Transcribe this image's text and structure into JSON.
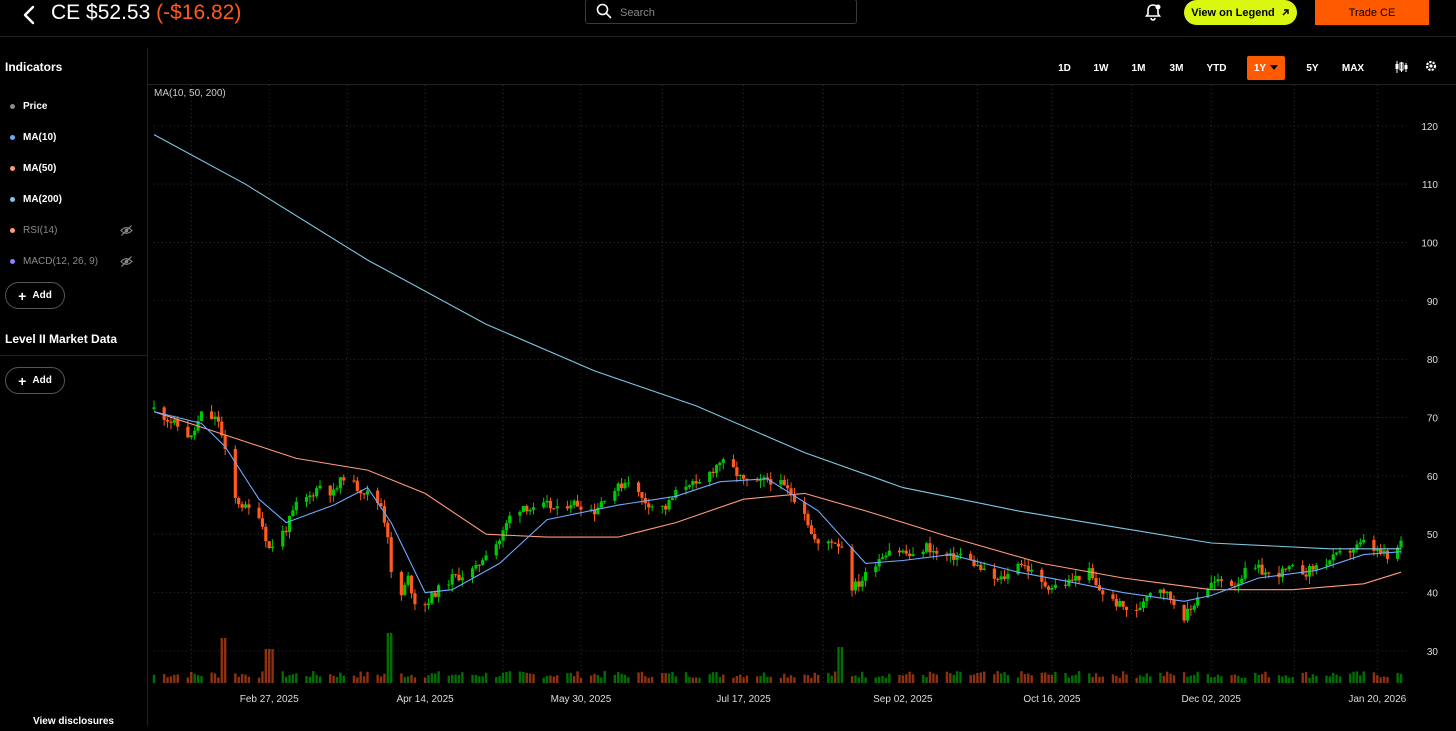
{
  "header": {
    "ticker": "CE",
    "price": "$52.53",
    "change": "(-$16.82)",
    "search_placeholder": "Search",
    "legend_button": "View on Legend",
    "trade_button": "Trade CE"
  },
  "sidebar": {
    "indicators_title": "Indicators",
    "indicators": [
      {
        "label": "Price",
        "color": "#8a8a8a",
        "hidden": false
      },
      {
        "label": "MA(10)",
        "color": "#6ea8ff",
        "hidden": false
      },
      {
        "label": "MA(50)",
        "color": "#ff9a7a",
        "hidden": false
      },
      {
        "label": "MA(200)",
        "color": "#7ec8e3",
        "hidden": false
      },
      {
        "label": "RSI(14)",
        "color": "#ff9a7a",
        "hidden": true
      },
      {
        "label": "MACD(12, 26, 9)",
        "color": "#9a7aff",
        "hidden": true
      }
    ],
    "add_label": "Add",
    "level2_title": "Level II Market Data",
    "add_label_2": "Add",
    "disclosures": "View disclosures"
  },
  "ranges": [
    "1D",
    "1W",
    "1M",
    "3M",
    "YTD",
    "1Y",
    "5Y",
    "MAX"
  ],
  "active_range": "1Y",
  "chart_data": {
    "type": "candlestick",
    "overlay_label": "MA(10, 50, 200)",
    "up_color": "#00c805",
    "down_color": "#ff5a1f",
    "ma10_color": "#6ea8ff",
    "ma50_color": "#ff9a7a",
    "ma200_color": "#7ec8e3",
    "y_ticks": [
      120,
      110,
      100,
      90,
      80,
      70,
      60,
      50,
      40,
      30
    ],
    "ylim": [
      24.5,
      127
    ],
    "x_range": [
      "2025-01-24",
      "2026-01-27"
    ],
    "x_ticks": [
      {
        "date": "2025-02-27",
        "label": "Feb 27, 2025"
      },
      {
        "date": "2025-04-14",
        "label": "Apr 14, 2025"
      },
      {
        "date": "2025-05-30",
        "label": "May 30, 2025"
      },
      {
        "date": "2025-07-17",
        "label": "Jul 17, 2025"
      },
      {
        "date": "2025-09-02",
        "label": "Sep 02, 2025"
      },
      {
        "date": "2025-10-16",
        "label": "Oct 16, 2025"
      },
      {
        "date": "2025-12-02",
        "label": "Dec 02, 2025"
      },
      {
        "date": "2026-01-20",
        "label": "Jan 20, 2026"
      }
    ],
    "price_path": [
      [
        "2025-01-24",
        71.5
      ],
      [
        "2025-01-31",
        68.5
      ],
      [
        "2025-02-04",
        66.5
      ],
      [
        "2025-02-07",
        70.5
      ],
      [
        "2025-02-12",
        69.5
      ],
      [
        "2025-02-14",
        64.0
      ],
      [
        "2025-02-17",
        56.0
      ],
      [
        "2025-02-20",
        54.5
      ],
      [
        "2025-02-24",
        53.5
      ],
      [
        "2025-02-27",
        47.5
      ],
      [
        "2025-03-04",
        51.0
      ],
      [
        "2025-03-07",
        55.0
      ],
      [
        "2025-03-11",
        56.5
      ],
      [
        "2025-03-14",
        58.5
      ],
      [
        "2025-03-18",
        57.0
      ],
      [
        "2025-03-21",
        60.0
      ],
      [
        "2025-03-25",
        58.0
      ],
      [
        "2025-03-28",
        57.0
      ],
      [
        "2025-04-01",
        55.0
      ],
      [
        "2025-04-03",
        50.0
      ],
      [
        "2025-04-04",
        43.0
      ],
      [
        "2025-04-07",
        39.5
      ],
      [
        "2025-04-09",
        42.5
      ],
      [
        "2025-04-11",
        38.5
      ],
      [
        "2025-04-14",
        38.0
      ],
      [
        "2025-04-17",
        40.0
      ],
      [
        "2025-04-22",
        42.5
      ],
      [
        "2025-04-25",
        43.0
      ],
      [
        "2025-04-29",
        44.0
      ],
      [
        "2025-05-02",
        47.0
      ],
      [
        "2025-05-06",
        49.0
      ],
      [
        "2025-05-09",
        53.0
      ],
      [
        "2025-05-13",
        55.0
      ],
      [
        "2025-05-16",
        54.0
      ],
      [
        "2025-05-20",
        55.0
      ],
      [
        "2025-05-23",
        54.0
      ],
      [
        "2025-05-27",
        55.5
      ],
      [
        "2025-05-30",
        55.0
      ],
      [
        "2025-06-03",
        54.0
      ],
      [
        "2025-06-06",
        56.5
      ],
      [
        "2025-06-10",
        58.0
      ],
      [
        "2025-06-13",
        59.5
      ],
      [
        "2025-06-17",
        56.0
      ],
      [
        "2025-06-20",
        55.0
      ],
      [
        "2025-06-24",
        54.5
      ],
      [
        "2025-06-27",
        57.0
      ],
      [
        "2025-07-01",
        59.0
      ],
      [
        "2025-07-03",
        58.0
      ],
      [
        "2025-07-07",
        60.5
      ],
      [
        "2025-07-10",
        62.5
      ],
      [
        "2025-07-14",
        61.0
      ],
      [
        "2025-07-17",
        59.0
      ],
      [
        "2025-07-21",
        58.5
      ],
      [
        "2025-07-24",
        59.5
      ],
      [
        "2025-07-28",
        58.5
      ],
      [
        "2025-07-31",
        57.0
      ],
      [
        "2025-08-04",
        54.0
      ],
      [
        "2025-08-06",
        50.0
      ],
      [
        "2025-08-08",
        48.0
      ],
      [
        "2025-08-12",
        49.0
      ],
      [
        "2025-08-15",
        48.0
      ],
      [
        "2025-08-18",
        41.0
      ],
      [
        "2025-08-20",
        41.5
      ],
      [
        "2025-08-22",
        43.0
      ],
      [
        "2025-08-26",
        46.0
      ],
      [
        "2025-08-29",
        47.5
      ],
      [
        "2025-09-02",
        47.0
      ],
      [
        "2025-09-05",
        46.0
      ],
      [
        "2025-09-09",
        48.0
      ],
      [
        "2025-09-12",
        46.5
      ],
      [
        "2025-09-16",
        46.0
      ],
      [
        "2025-09-19",
        46.5
      ],
      [
        "2025-09-23",
        45.0
      ],
      [
        "2025-09-26",
        43.5
      ],
      [
        "2025-09-30",
        42.0
      ],
      [
        "2025-10-03",
        43.0
      ],
      [
        "2025-10-06",
        45.5
      ],
      [
        "2025-10-09",
        44.0
      ],
      [
        "2025-10-13",
        41.5
      ],
      [
        "2025-10-16",
        41.0
      ],
      [
        "2025-10-20",
        41.5
      ],
      [
        "2025-10-23",
        42.5
      ],
      [
        "2025-10-27",
        43.5
      ],
      [
        "2025-10-29",
        41.0
      ],
      [
        "2025-11-03",
        38.5
      ],
      [
        "2025-11-06",
        37.5
      ],
      [
        "2025-11-10",
        36.5
      ],
      [
        "2025-11-13",
        40.0
      ],
      [
        "2025-11-17",
        41.0
      ],
      [
        "2025-11-20",
        39.0
      ],
      [
        "2025-11-24",
        36.0
      ],
      [
        "2025-11-26",
        37.0
      ],
      [
        "2025-11-28",
        39.5
      ],
      [
        "2025-12-02",
        41.5
      ],
      [
        "2025-12-05",
        42.0
      ],
      [
        "2025-12-09",
        41.5
      ],
      [
        "2025-12-12",
        43.5
      ],
      [
        "2025-12-16",
        44.0
      ],
      [
        "2025-12-19",
        43.0
      ],
      [
        "2025-12-23",
        43.5
      ],
      [
        "2025-12-26",
        44.0
      ],
      [
        "2025-12-30",
        43.5
      ],
      [
        "2026-01-02",
        44.5
      ],
      [
        "2026-01-06",
        45.5
      ],
      [
        "2026-01-09",
        46.5
      ],
      [
        "2026-01-13",
        47.5
      ],
      [
        "2026-01-16",
        48.5
      ],
      [
        "2026-01-20",
        47.0
      ],
      [
        "2026-01-22",
        46.5
      ],
      [
        "2026-01-24",
        45.0
      ],
      [
        "2026-01-26",
        47.5
      ],
      [
        "2026-01-27",
        48.5
      ]
    ],
    "ma10": [
      [
        "2025-01-24",
        71.0
      ],
      [
        "2025-02-07",
        69.0
      ],
      [
        "2025-02-14",
        65.0
      ],
      [
        "2025-02-24",
        56.0
      ],
      [
        "2025-03-04",
        52.0
      ],
      [
        "2025-03-18",
        55.0
      ],
      [
        "2025-03-28",
        58.0
      ],
      [
        "2025-04-04",
        52.0
      ],
      [
        "2025-04-14",
        40.0
      ],
      [
        "2025-04-22",
        40.5
      ],
      [
        "2025-05-06",
        45.0
      ],
      [
        "2025-05-20",
        52.5
      ],
      [
        "2025-06-10",
        55.0
      ],
      [
        "2025-06-27",
        56.5
      ],
      [
        "2025-07-10",
        59.0
      ],
      [
        "2025-07-24",
        59.5
      ],
      [
        "2025-08-08",
        54.0
      ],
      [
        "2025-08-22",
        45.0
      ],
      [
        "2025-09-02",
        45.5
      ],
      [
        "2025-09-16",
        46.5
      ],
      [
        "2025-10-06",
        43.5
      ],
      [
        "2025-10-20",
        42.0
      ],
      [
        "2025-11-06",
        40.0
      ],
      [
        "2025-11-24",
        38.5
      ],
      [
        "2025-12-02",
        39.5
      ],
      [
        "2025-12-16",
        42.5
      ],
      [
        "2026-01-02",
        43.8
      ],
      [
        "2026-01-16",
        46.5
      ],
      [
        "2026-01-27",
        47.0
      ]
    ],
    "ma50": [
      [
        "2025-01-24",
        71.0
      ],
      [
        "2025-02-14",
        67.0
      ],
      [
        "2025-03-07",
        63.0
      ],
      [
        "2025-03-28",
        61.0
      ],
      [
        "2025-04-14",
        57.0
      ],
      [
        "2025-05-02",
        50.0
      ],
      [
        "2025-05-20",
        49.5
      ],
      [
        "2025-06-10",
        49.5
      ],
      [
        "2025-06-27",
        52.0
      ],
      [
        "2025-07-17",
        56.0
      ],
      [
        "2025-08-04",
        57.0
      ],
      [
        "2025-08-22",
        54.0
      ],
      [
        "2025-09-16",
        49.5
      ],
      [
        "2025-10-13",
        45.0
      ],
      [
        "2025-11-06",
        42.5
      ],
      [
        "2025-12-02",
        40.5
      ],
      [
        "2025-12-26",
        40.5
      ],
      [
        "2026-01-16",
        41.5
      ],
      [
        "2026-01-27",
        43.5
      ]
    ],
    "ma200": [
      [
        "2025-01-24",
        118.5
      ],
      [
        "2025-02-20",
        110.0
      ],
      [
        "2025-03-28",
        97.0
      ],
      [
        "2025-05-02",
        86.0
      ],
      [
        "2025-06-03",
        78.0
      ],
      [
        "2025-07-03",
        72.0
      ],
      [
        "2025-08-04",
        64.0
      ],
      [
        "2025-09-02",
        58.0
      ],
      [
        "2025-10-06",
        54.0
      ],
      [
        "2025-11-06",
        51.0
      ],
      [
        "2025-12-02",
        48.5
      ],
      [
        "2026-01-06",
        47.5
      ],
      [
        "2026-01-27",
        47.5
      ]
    ],
    "volume_spikes": [
      {
        "date": "2025-02-14",
        "level": 0.9,
        "direction": "down"
      },
      {
        "date": "2025-02-27",
        "level": 0.68,
        "direction": "down"
      },
      {
        "date": "2025-04-04",
        "level": 1.0,
        "direction": "up"
      },
      {
        "date": "2025-08-15",
        "level": 0.72,
        "direction": "up"
      }
    ]
  }
}
